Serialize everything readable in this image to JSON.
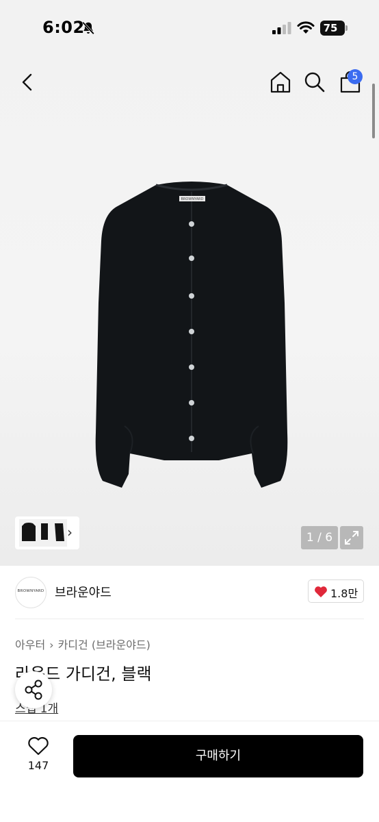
{
  "status_bar": {
    "time": "6:02",
    "battery": "75",
    "icons": [
      "bell-muted-icon",
      "signal-icon",
      "wifi-icon",
      "battery-icon"
    ]
  },
  "nav": {
    "cart_count": "5",
    "icons": [
      "back-icon",
      "home-icon",
      "search-icon",
      "cart-icon"
    ]
  },
  "gallery": {
    "counter": "1 / 6",
    "thumb_more": "›",
    "product_label": "BROWNYARD"
  },
  "brand": {
    "logo_text": "BROWNYARD",
    "name": "브라운야드",
    "likes": "1.8만"
  },
  "breadcrumb": {
    "category": "아우터",
    "separator": "›",
    "subcategory": "카디건 (브라운야드)"
  },
  "product": {
    "title": "라운드 가디건, 블랙",
    "review_link": "스냅 1개"
  },
  "bottom": {
    "wish_count": "147",
    "buy_label": "구매하기"
  },
  "colors": {
    "accent_badge": "#3b6cf0",
    "heart": "#e0283a",
    "buy_button": "#000000"
  }
}
